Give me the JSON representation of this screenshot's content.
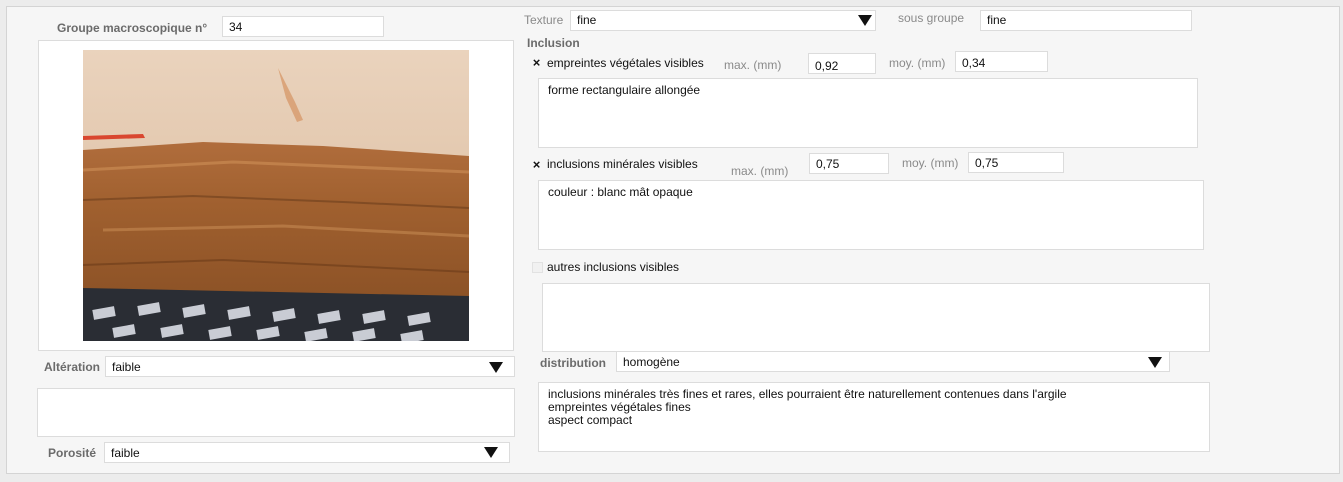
{
  "groupe": {
    "label": "Groupe macroscopique n°",
    "value": "34"
  },
  "texture": {
    "label": "Texture",
    "value": "fine"
  },
  "sous_groupe": {
    "label": "sous groupe",
    "value": "fine"
  },
  "inclusion": {
    "label": "Inclusion"
  },
  "empreintes": {
    "checked_mark": "×",
    "label": "empreintes végétales visibles",
    "max_label": "max. (mm)",
    "max_value": "0,92",
    "moy_label": "moy. (mm)",
    "moy_value": "0,34",
    "comment": "forme rectangulaire allongée"
  },
  "minerales": {
    "checked_mark": "×",
    "label": "inclusions minérales visibles",
    "max_label": "max. (mm)",
    "max_value": "0,75",
    "moy_label": "moy. (mm)",
    "moy_value": "0,75",
    "comment": "couleur : blanc mât opaque"
  },
  "autres": {
    "label": "autres inclusions visibles",
    "comment": ""
  },
  "distribution": {
    "label": "distribution",
    "value": "homogène",
    "comment": "inclusions minérales très fines et rares, elles pourraient être naturellement contenues dans l'argile\nempreintes végétales fines\naspect compact"
  },
  "alteration": {
    "label": "Altération",
    "value": "faible",
    "comment": ""
  },
  "porosite": {
    "label": "Porosité",
    "value": "faible"
  },
  "colors": {
    "background": "#f6f6f6",
    "field": "#ffffff",
    "label_gray": "#6b6b6b",
    "arrow": "#111111"
  },
  "icons": {
    "dropdown": "triangle-down",
    "photo": "ceramic-sample-photo"
  }
}
